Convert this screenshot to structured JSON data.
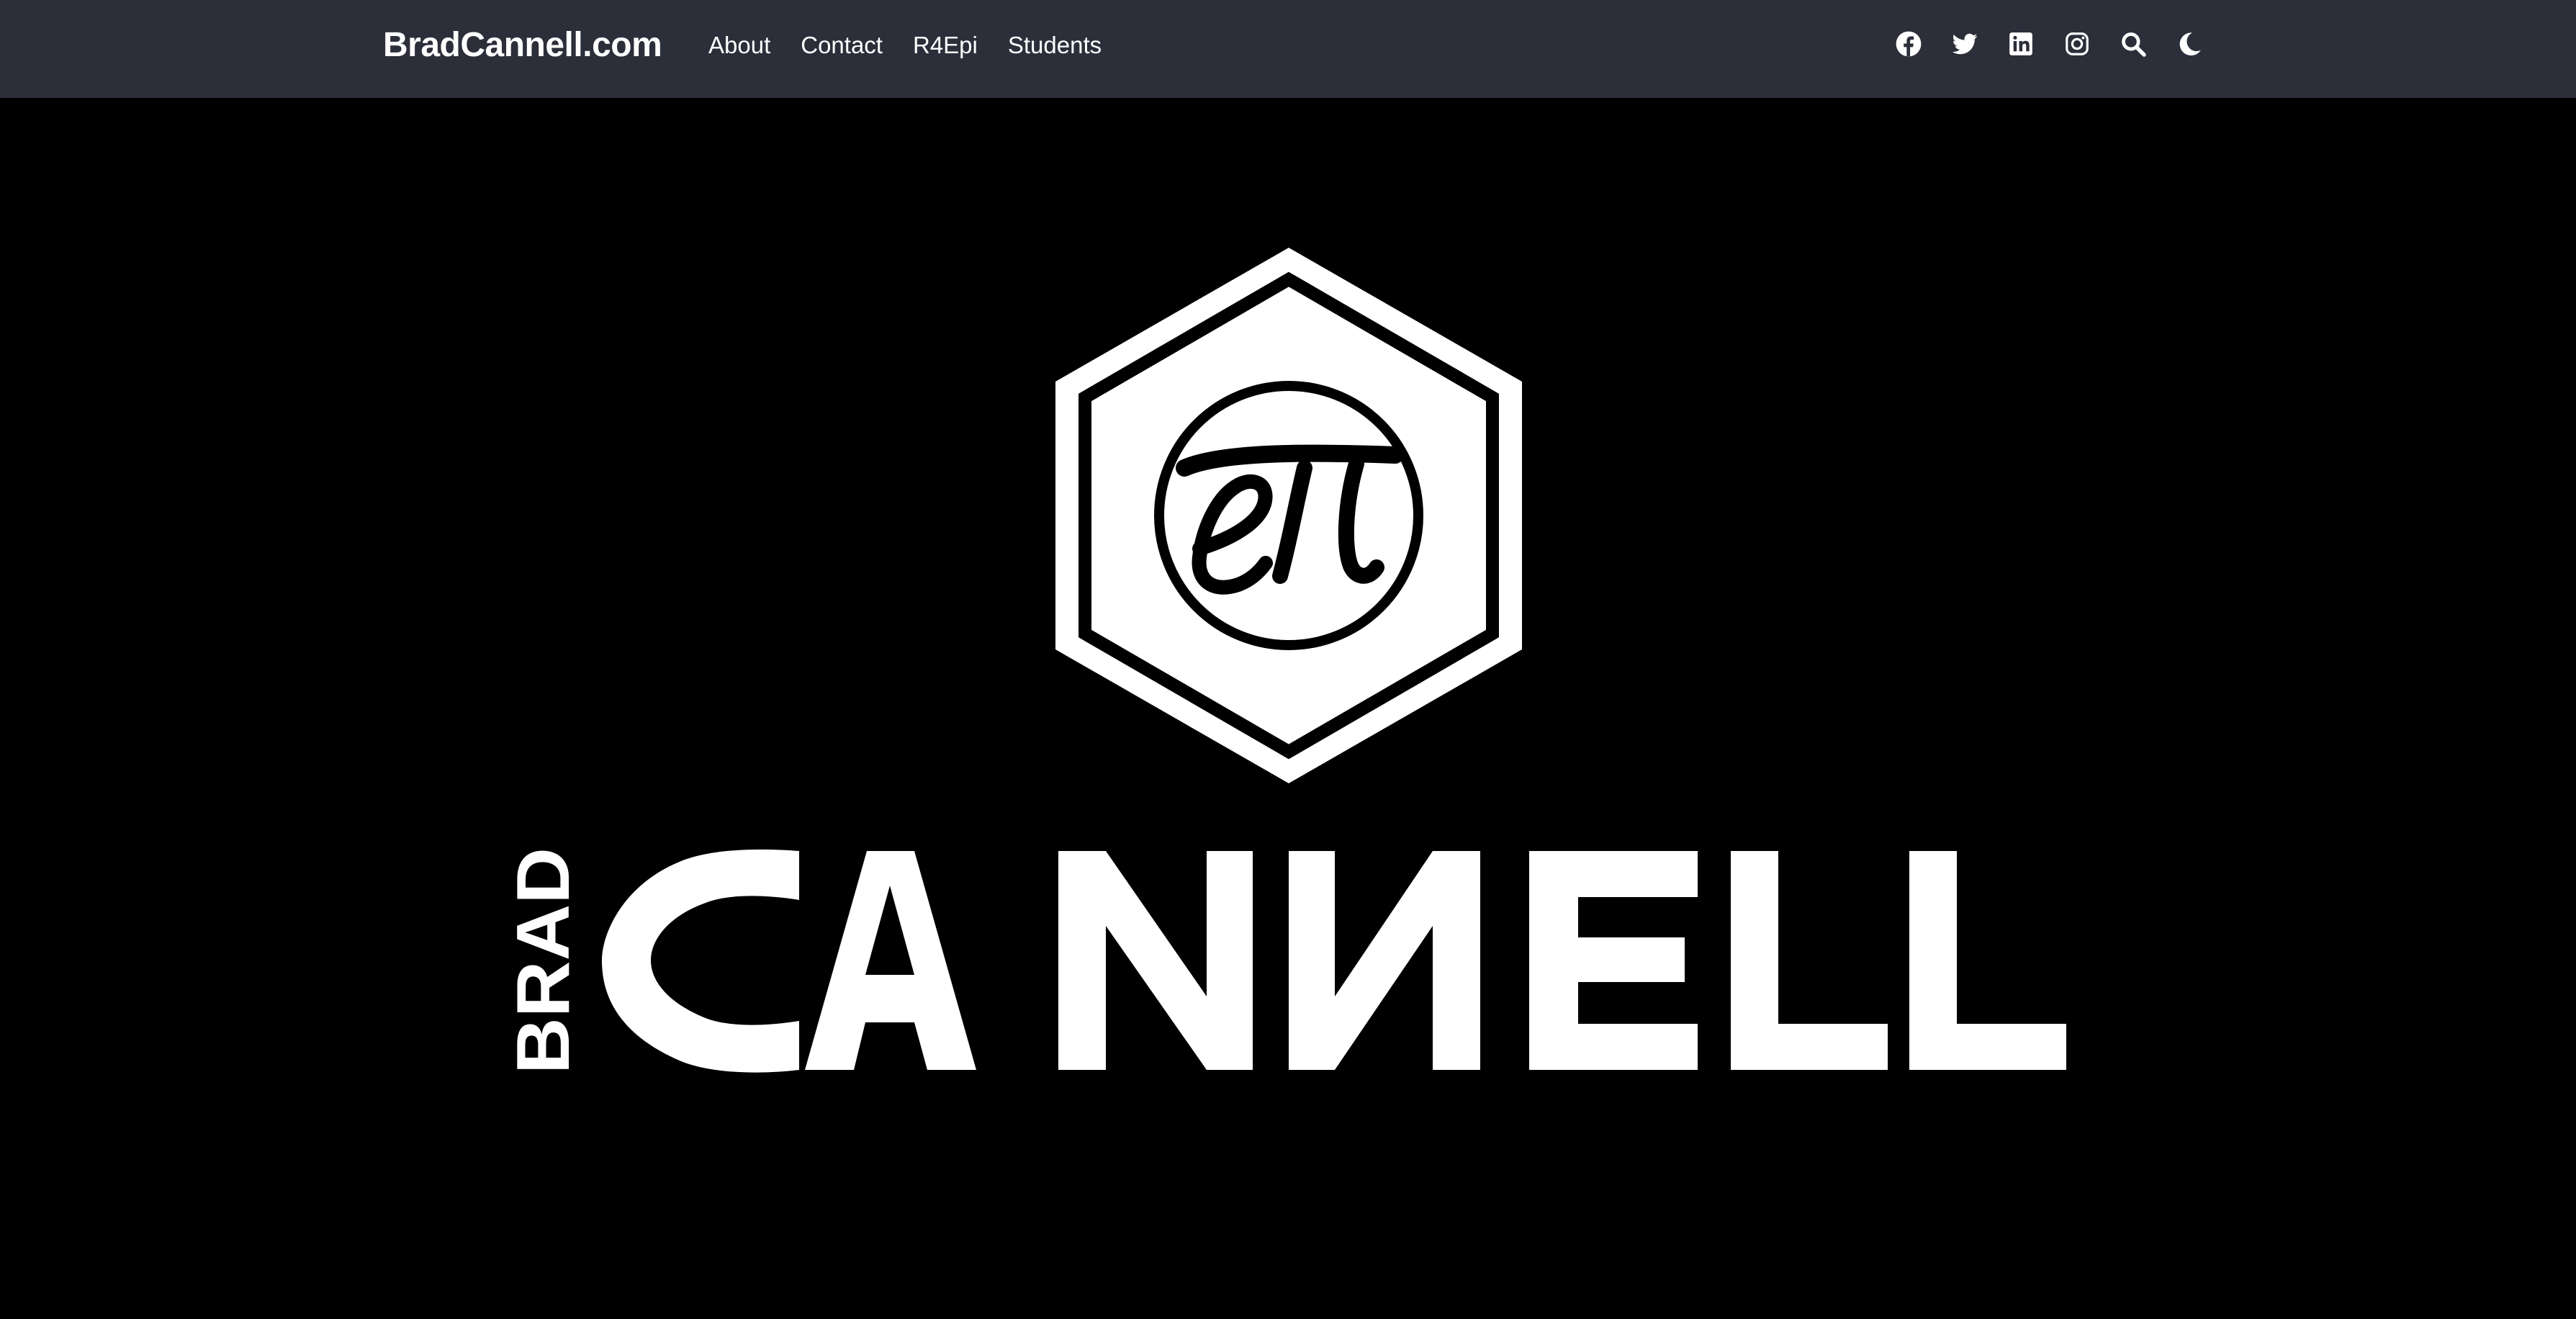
{
  "navbar": {
    "brand": "BradCannell.com",
    "links": [
      {
        "label": "About"
      },
      {
        "label": "Contact"
      },
      {
        "label": "R4Epi"
      },
      {
        "label": "Students"
      }
    ],
    "icons": [
      "facebook-icon",
      "twitter-icon",
      "linkedin-icon",
      "instagram-icon",
      "search-icon",
      "dark-mode-moon-icon"
    ]
  },
  "hero": {
    "logo": {
      "symbol": "eπ",
      "first_name": "BRAD",
      "last_name": "CANNELL"
    }
  },
  "colors": {
    "navbar_bg": "#2c2e3a",
    "hero_bg": "#000000",
    "text": "#ffffff"
  }
}
